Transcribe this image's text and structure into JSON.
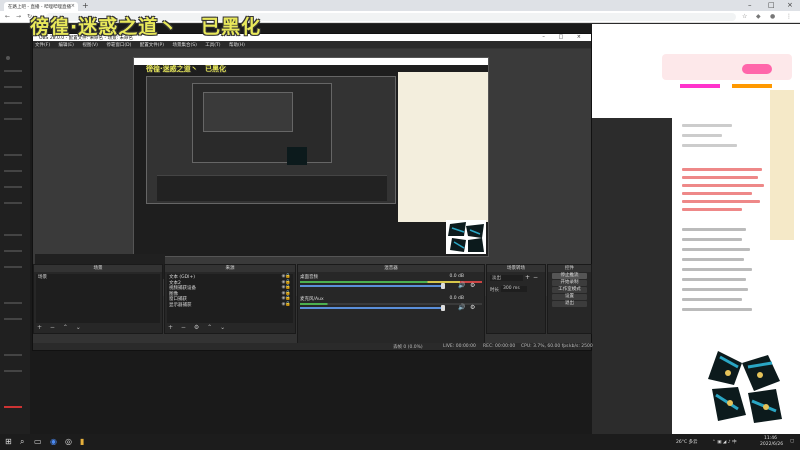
{
  "browser": {
    "tab_title": "在路上吧 - 直播 - 哔哩哔哩直播",
    "tab_close": "×",
    "new_tab": "+",
    "win_min": "–",
    "win_max": "□",
    "win_close": "×",
    "back_icon": "arrow-left-icon",
    "forward_icon": "arrow-right-icon",
    "reload_icon": "reload-icon"
  },
  "overlay_title": "徬徨·迷惑之道丶   已黑化",
  "obs": {
    "title": "OBS 28.0.0 - 配置文件: 未命名 - 场景: 未命名",
    "menu": [
      "文件(F)",
      "编辑(E)",
      "视图(V)",
      "停靠窗口(D)",
      "配置文件(P)",
      "场景集合(S)",
      "工具(T)",
      "帮助(H)"
    ],
    "scenes": {
      "header": "场景",
      "items": [
        "场景"
      ]
    },
    "sources": {
      "header": "来源",
      "items": [
        "文本 (GDI+)",
        "文本2",
        "视频捕获设备",
        "图像",
        "窗口捕获",
        "显示器捕获"
      ]
    },
    "mixer": {
      "header": "混音器",
      "tracks": [
        {
          "name": "桌面音频",
          "db": "0.0 dB"
        },
        {
          "name": "麦克风/Aux",
          "db": "0.0 dB"
        }
      ]
    },
    "transitions": {
      "header": "场景转场",
      "type": "淡出",
      "duration_label": "时长",
      "duration": "300 ms"
    },
    "controls": {
      "header": "控件",
      "buttons": [
        "停止推流",
        "开始录制",
        "工作室模式",
        "设置",
        "退出"
      ]
    },
    "status": {
      "dropped": "丢帧 0 (0.0%)",
      "live": "LIVE: 00:00:00",
      "rec": "REC: 00:00:00",
      "cpu": "CPU: 3.7%, 60.00 fps",
      "kbps": "kb/s: 2500"
    },
    "dock_foot_scenes": "+ − ⌃ ⌄",
    "dock_foot_sources": "+ − ⚙ ⌃ ⌄"
  },
  "taskbar": {
    "weather": "26°C 多云",
    "time": "11:46",
    "date": "2022/6/26"
  }
}
